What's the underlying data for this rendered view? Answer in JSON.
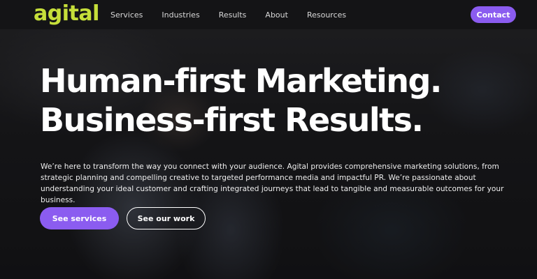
{
  "brand": {
    "logo_text": "agital",
    "accent_color": "#c6df3a",
    "button_color": "#8b5cf0"
  },
  "nav": {
    "items": [
      {
        "label": "Services"
      },
      {
        "label": "Industries"
      },
      {
        "label": "Results"
      },
      {
        "label": "About"
      },
      {
        "label": "Resources"
      }
    ],
    "contact_label": "Contact"
  },
  "hero": {
    "headline_line1": "Human-first Marketing.",
    "headline_line2": "Business-first Results.",
    "body": "We’re here to transform the way you connect with your audience. Agital provides comprehensive marketing solutions, from strategic planning and compelling creative to targeted performance media and impactful PR. We’re passionate about understanding your ideal customer and crafting integrated journeys that lead to tangible and measurable outcomes for your business.",
    "primary_cta": "See services",
    "secondary_cta": "See our work"
  }
}
